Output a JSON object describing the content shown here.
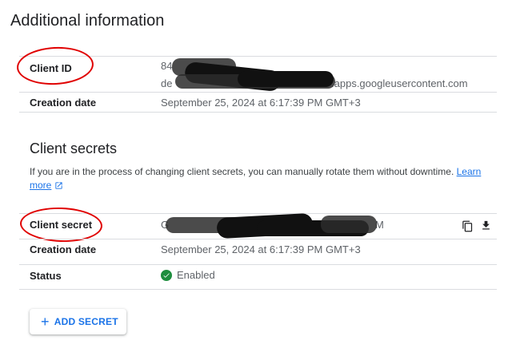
{
  "page": {
    "title": "Additional information"
  },
  "client_id_row": {
    "label": "Client ID",
    "value_prefix": "84",
    "value_line2_prefix": "de",
    "value_suffix": "apps.googleusercontent.com"
  },
  "client_id_creation": {
    "label": "Creation date",
    "value": "September 25, 2024 at 6:17:39 PM GMT+3"
  },
  "client_secrets": {
    "title": "Client secrets",
    "description": "If you are in the process of changing client secrets, you can manually rotate them without downtime.",
    "learn_more": "Learn more"
  },
  "secret_row": {
    "label": "Client secret",
    "value_prefix": "G",
    "value_suffix": "M"
  },
  "secret_creation": {
    "label": "Creation date",
    "value": "September 25, 2024 at 6:17:39 PM GMT+3"
  },
  "secret_status": {
    "label": "Status",
    "value": "Enabled"
  },
  "add_secret": {
    "label": "ADD SECRET"
  },
  "colors": {
    "accent": "#1a73e8",
    "success": "#1e8e3e",
    "annotation": "#e00000"
  },
  "icons": [
    "copy-icon",
    "download-icon",
    "external-link-icon",
    "check-circle-icon",
    "plus-icon"
  ]
}
